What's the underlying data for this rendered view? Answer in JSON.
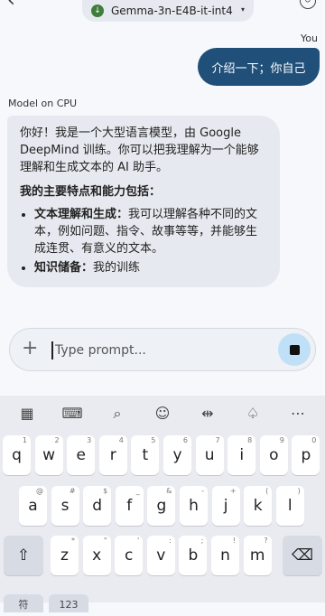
{
  "header": {
    "model_name": "Gemma-3n-E4B-it-int4",
    "caret": "▾",
    "back_icon": "back-arrow-icon"
  },
  "chat": {
    "user_label": "You",
    "user_message": "介绍一下；你自己",
    "model_label": "Model on CPU",
    "model_intro": "你好！我是一个大型语言模型，由 Google DeepMind 训练。你可以把我理解为一个能够理解和生成文本的 AI 助手。",
    "model_heading": "我的主要特点和能力包括：",
    "bullets": [
      {
        "title": "文本理解和生成：",
        "text": "我可以理解各种不同的文本，例如问题、指令、故事等等，并能够生成连贯、有意义的文本。"
      },
      {
        "title": "知识储备：",
        "text": "我的训练"
      }
    ]
  },
  "input": {
    "placeholder": "Type prompt..."
  },
  "keyboard": {
    "row1": [
      {
        "k": "q",
        "h": "1"
      },
      {
        "k": "w",
        "h": "2"
      },
      {
        "k": "e",
        "h": "3"
      },
      {
        "k": "r",
        "h": "4"
      },
      {
        "k": "t",
        "h": "5"
      },
      {
        "k": "y",
        "h": "6"
      },
      {
        "k": "u",
        "h": "7"
      },
      {
        "k": "i",
        "h": "8"
      },
      {
        "k": "o",
        "h": "9"
      },
      {
        "k": "p",
        "h": "0"
      }
    ],
    "row2": [
      {
        "k": "a",
        "h": "@"
      },
      {
        "k": "s",
        "h": "#"
      },
      {
        "k": "d",
        "h": "$"
      },
      {
        "k": "f",
        "h": "_"
      },
      {
        "k": "g",
        "h": "&"
      },
      {
        "k": "h",
        "h": "-"
      },
      {
        "k": "j",
        "h": "+"
      },
      {
        "k": "k",
        "h": "("
      },
      {
        "k": "l",
        "h": ")"
      }
    ],
    "row3": [
      {
        "k": "z",
        "h": "*"
      },
      {
        "k": "x",
        "h": "\""
      },
      {
        "k": "c",
        "h": "'"
      },
      {
        "k": "v",
        "h": ":"
      },
      {
        "k": "b",
        "h": ";"
      },
      {
        "k": "n",
        "h": "!"
      },
      {
        "k": "m",
        "h": "?"
      }
    ],
    "shift": "⇧",
    "backspace": "⌫",
    "bottom_left": "符",
    "bottom_num": "123"
  }
}
